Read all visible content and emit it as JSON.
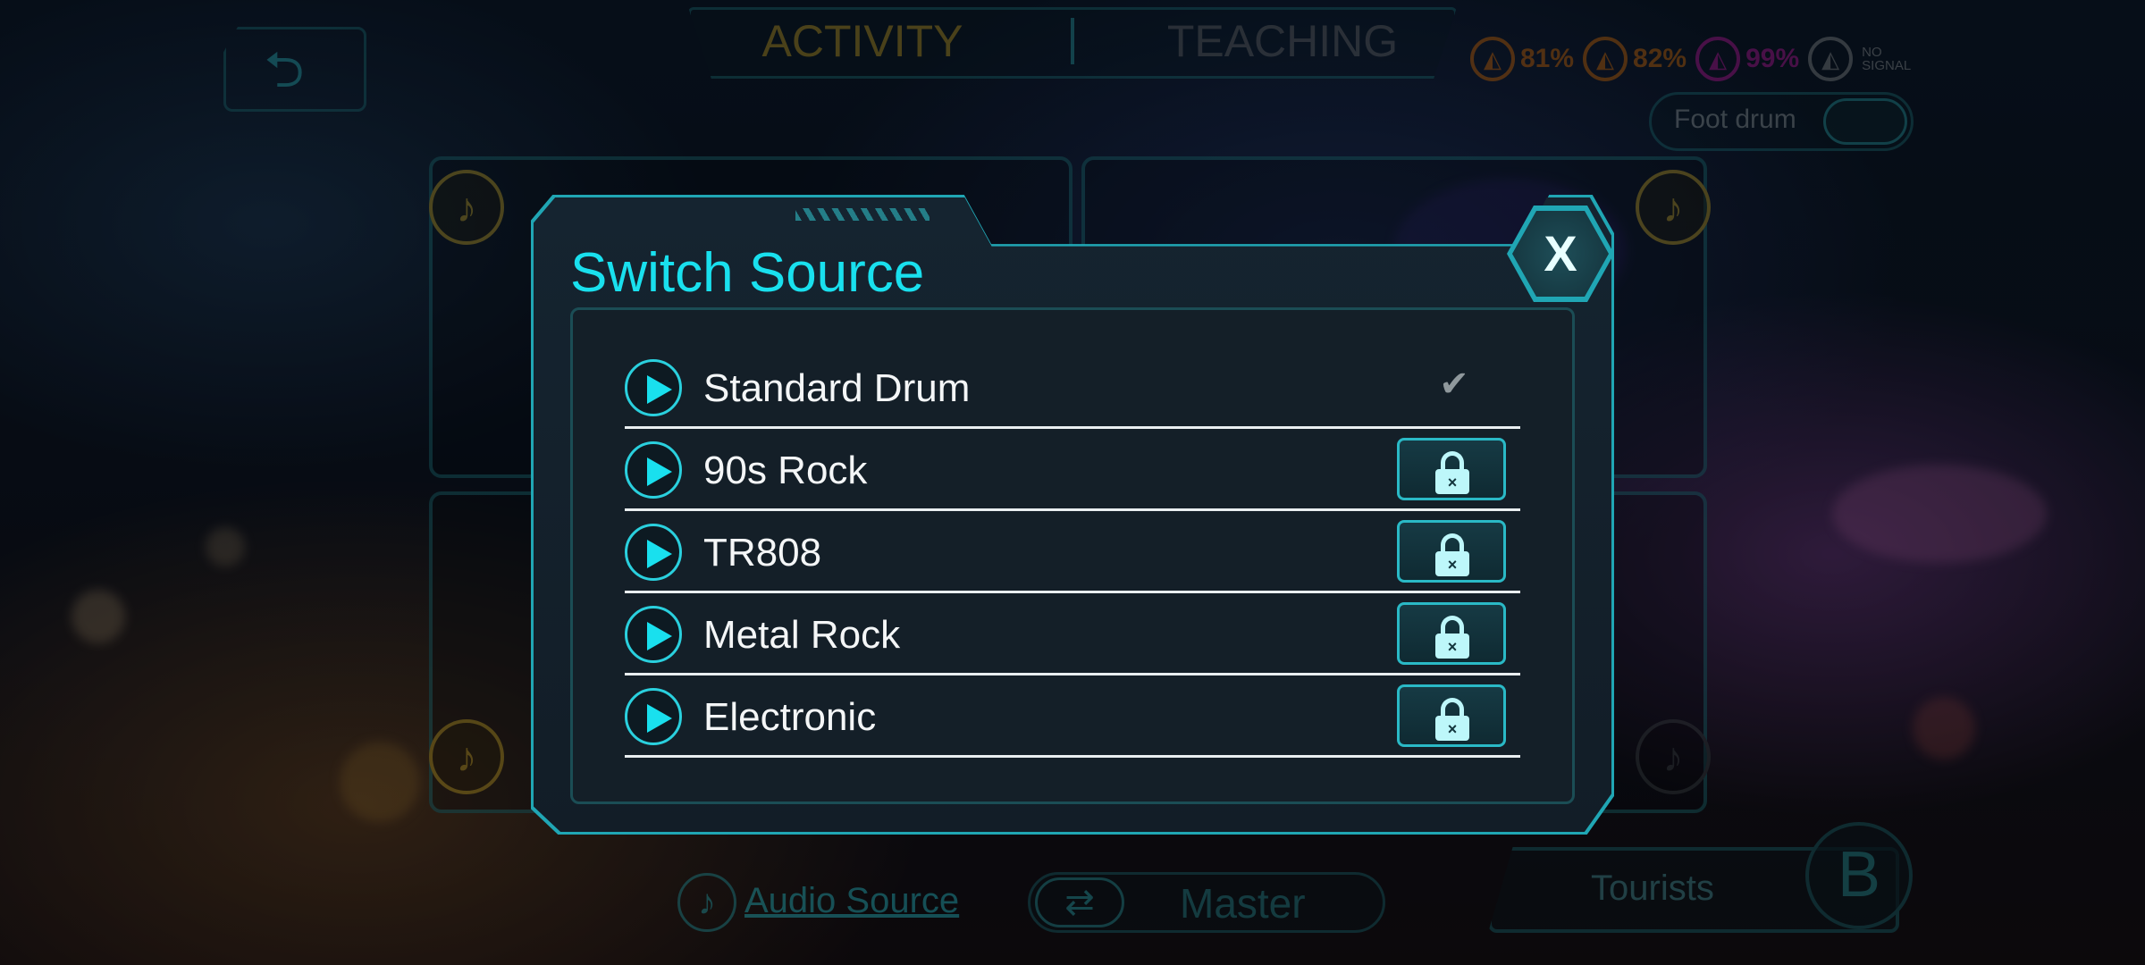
{
  "header": {
    "tabs": [
      {
        "label": "ACTIVITY",
        "active": true
      },
      {
        "label": "TEACHING",
        "active": false
      }
    ],
    "battery": [
      {
        "value": "81%",
        "color": "#d9730f"
      },
      {
        "value": "82%",
        "color": "#d9730f"
      },
      {
        "value": "99%",
        "color": "#c21ea8"
      }
    ],
    "no_signal_label": "NO SIGNAL",
    "foot_drum_label": "Foot drum"
  },
  "footer": {
    "audio_source_label": "Audio Source",
    "master_label": "Master",
    "tourists_label": "Tourists",
    "badge_letter": "B"
  },
  "modal": {
    "title": "Switch Source",
    "close_label": "X",
    "sources": [
      {
        "name": "Standard Drum",
        "state": "selected"
      },
      {
        "name": "90s Rock",
        "state": "locked"
      },
      {
        "name": "TR808",
        "state": "locked"
      },
      {
        "name": "Metal Rock",
        "state": "locked"
      },
      {
        "name": "Electronic",
        "state": "locked"
      }
    ]
  },
  "colors": {
    "accent": "#19e0ee",
    "frame": "#20a6b4",
    "activity_tab": "#c7a72a"
  },
  "icons": {
    "back": "back-arrow-icon",
    "play": "play-icon",
    "check": "check-icon",
    "lock": "lock-icon",
    "note": "music-note-icon",
    "swap": "swap-icon"
  }
}
